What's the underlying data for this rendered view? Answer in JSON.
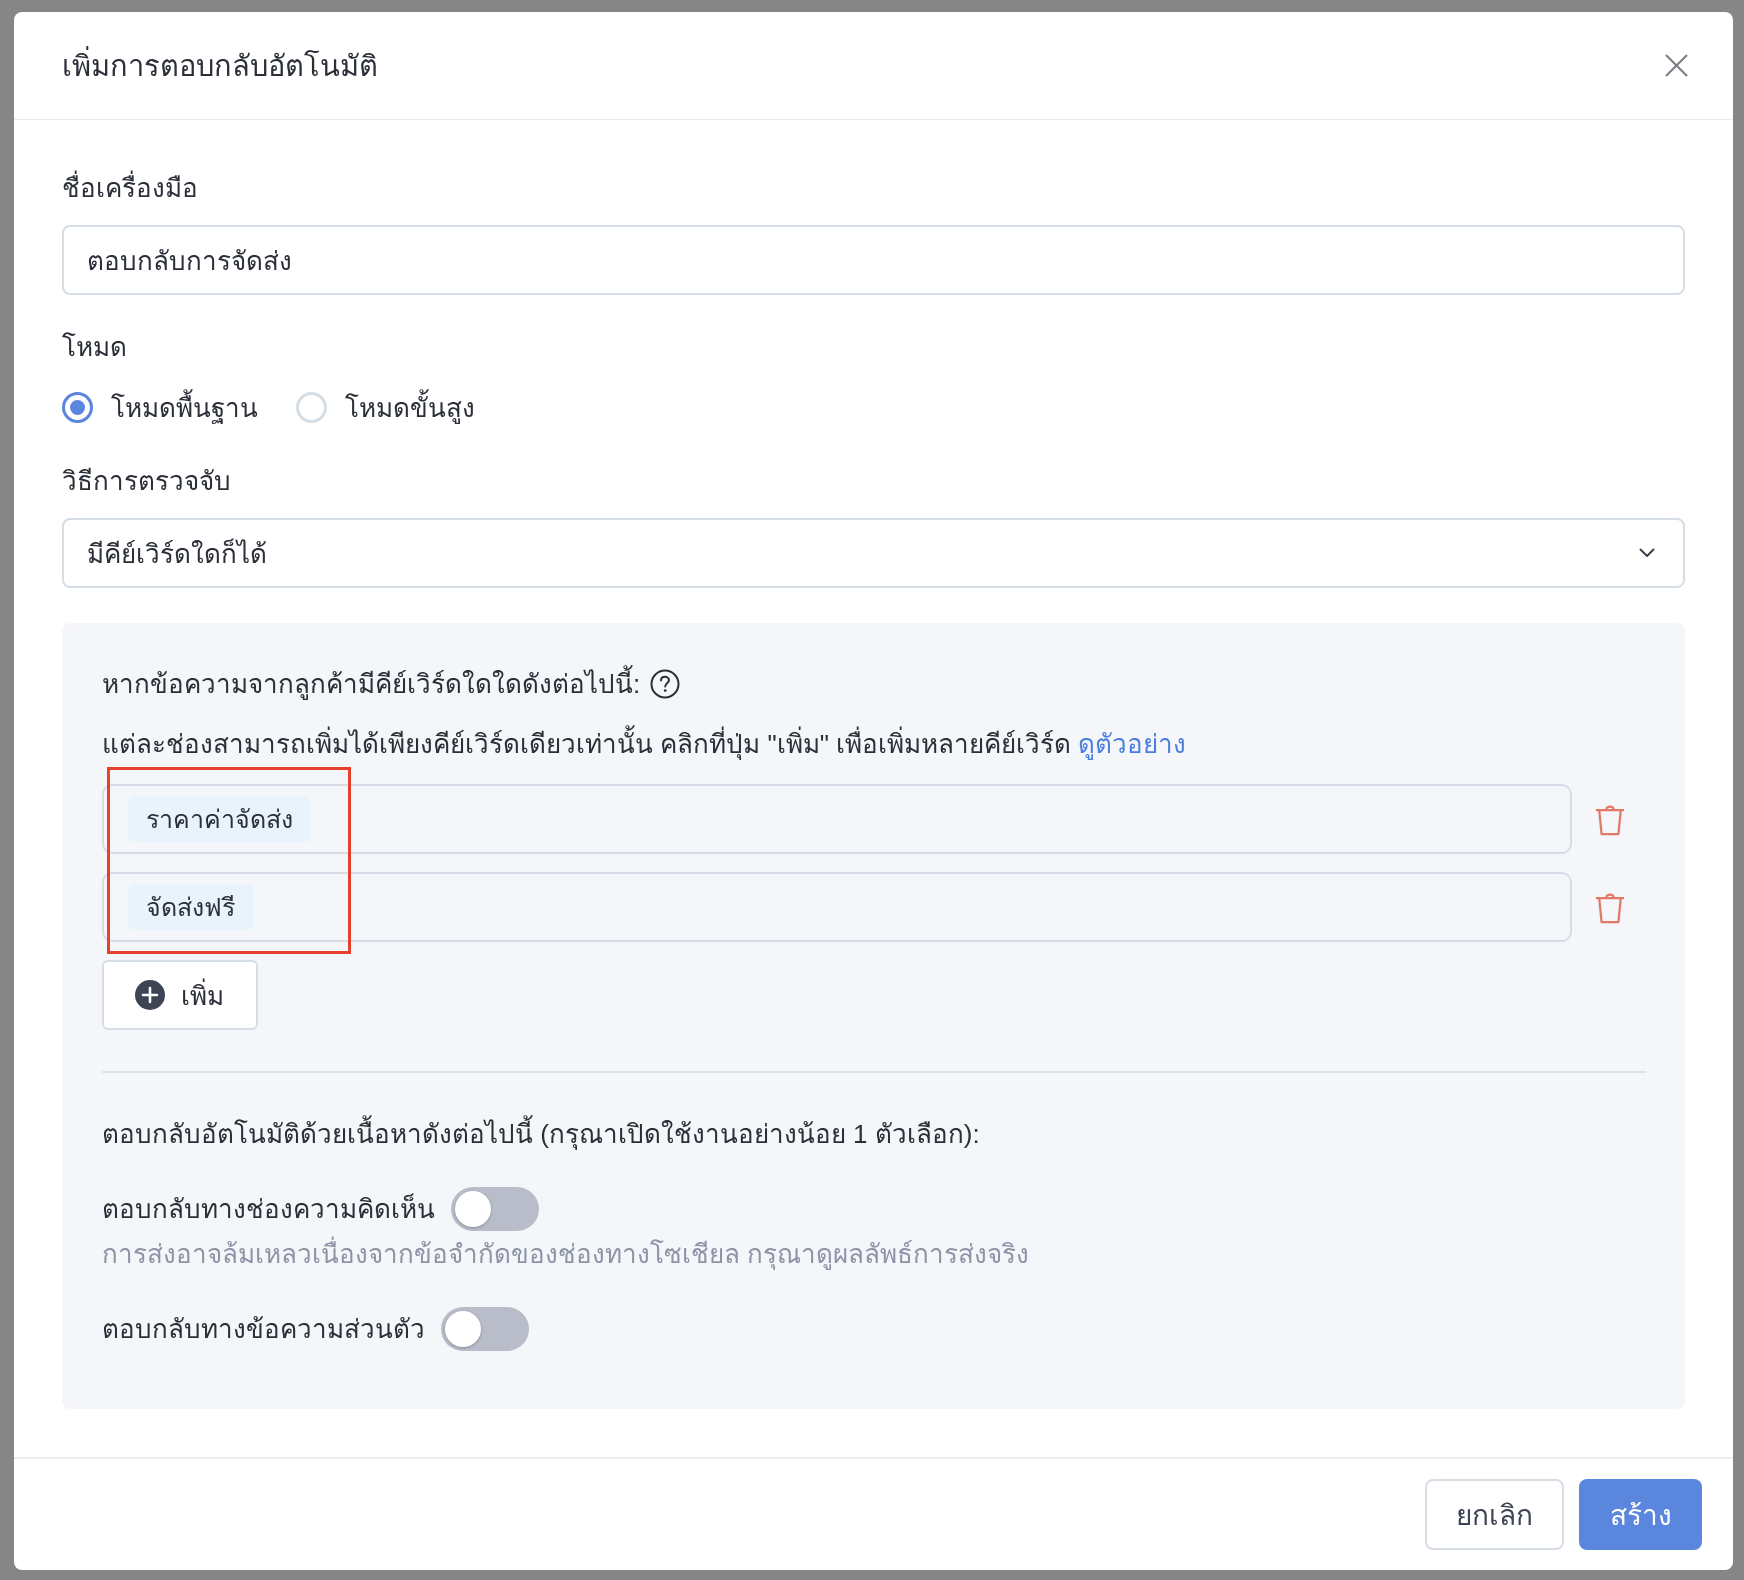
{
  "dialog": {
    "title": "เพิ่มการตอบกลับอัตโนมัติ"
  },
  "tool_name": {
    "label": "ชื่อเครื่องมือ",
    "value": "ตอบกลับการจัดส่ง"
  },
  "mode": {
    "label": "โหมด",
    "options": [
      {
        "label": "โหมดพื้นฐาน",
        "selected": true
      },
      {
        "label": "โหมดขั้นสูง",
        "selected": false
      }
    ]
  },
  "detection": {
    "label": "วิธีการตรวจจับ",
    "value": "มีคีย์เวิร์ดใดก็ได้"
  },
  "keywords": {
    "heading": "หากข้อความจากลูกค้ามีคีย์เวิร์ดใดใดดังต่อไปนี้:",
    "instruction": "แต่ละช่องสามารถเพิ่มได้เพียงคีย์เวิร์ดเดียวเท่านั้น คลิกที่ปุ่ม \"เพิ่ม\" เพื่อเพิ่มหลายคีย์เวิร์ด",
    "example_link": "ดูตัวอย่าง",
    "entries": [
      {
        "tag": "ราคาค่าจัดส่ง"
      },
      {
        "tag": "จัดส่งฟรี"
      }
    ],
    "highlighted": true,
    "add_button": "เพิ่ม"
  },
  "replies": {
    "heading": "ตอบกลับอัตโนมัติด้วยเนื้อหาดังต่อไปนี้ (กรุณาเปิดใช้งานอย่างน้อย 1 ตัวเลือก):",
    "options": [
      {
        "label": "ตอบกลับทางช่องความคิดเห็น",
        "on": false,
        "note": "การส่งอาจล้มเหลวเนื่องจากข้อจำกัดของช่องทางโซเชียล กรุณาดูผลลัพธ์การส่งจริง"
      },
      {
        "label": "ตอบกลับทางข้อความส่วนตัว",
        "on": false
      }
    ]
  },
  "buttons": [
    {
      "label": "ยกเลิก",
      "kind": "secondary"
    },
    {
      "label": "สร้าง",
      "kind": "primary"
    }
  ]
}
